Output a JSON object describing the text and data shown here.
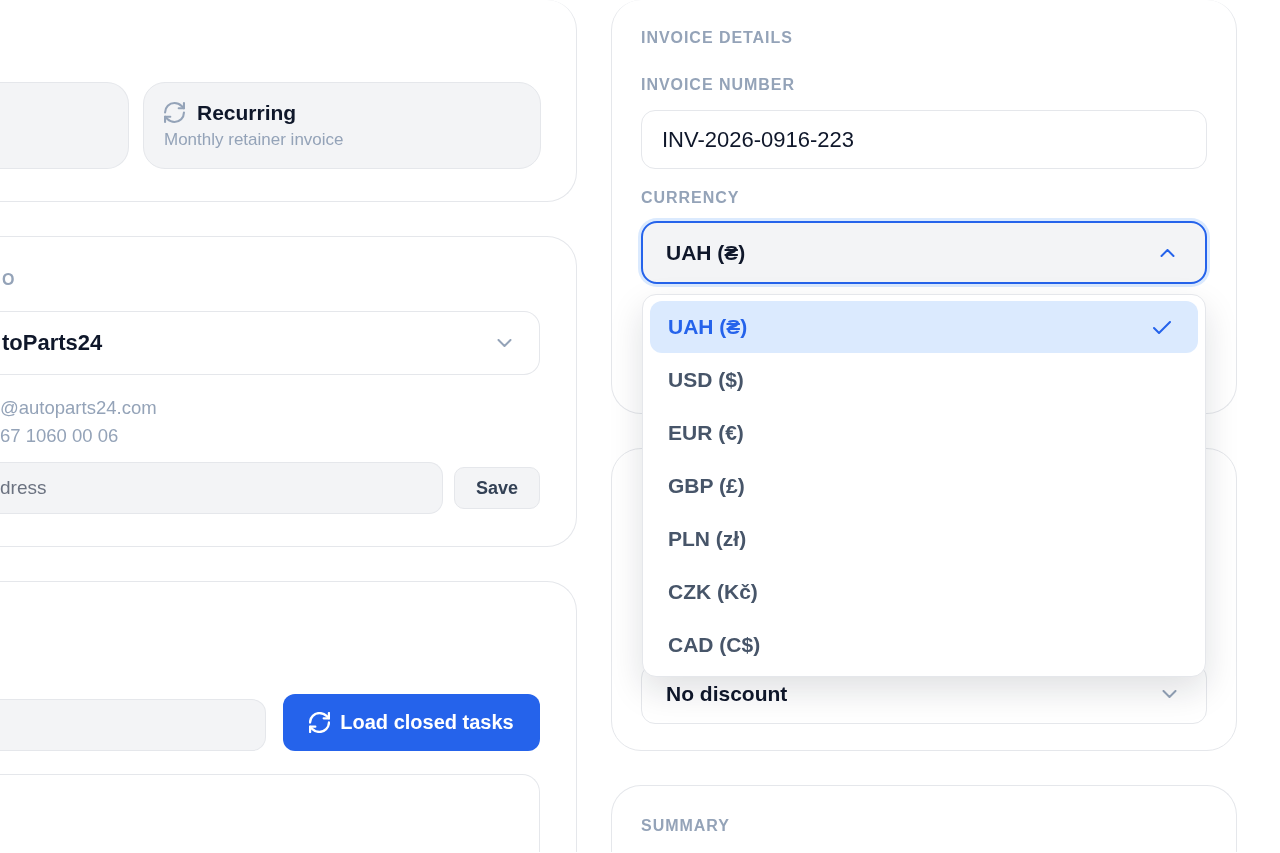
{
  "billing_type": {
    "options": [
      {
        "selected": false
      },
      {
        "title": "Recurring",
        "description": "Monthly retainer invoice",
        "selected": false
      }
    ]
  },
  "client": {
    "label": "O",
    "select": {
      "value": "toParts24"
    },
    "email": "@autoparts24.com",
    "phone": "67 1060 00 06",
    "address": {
      "placeholder": "dress"
    },
    "save_button": "Save"
  },
  "tasks": {
    "load_button": "Load closed tasks"
  },
  "invoice_details": {
    "title": "INVOICE DETAILS",
    "invoice_number": {
      "label": "INVOICE NUMBER",
      "value": "INV-2026-0916-223"
    },
    "currency": {
      "label": "CURRENCY",
      "value": "UAH (₴)",
      "expanded": true,
      "options": [
        {
          "label": "UAH (₴)",
          "selected": true
        },
        {
          "label": "USD ($)",
          "selected": false
        },
        {
          "label": "EUR (€)",
          "selected": false
        },
        {
          "label": "GBP (£)",
          "selected": false
        },
        {
          "label": "PLN (zł)",
          "selected": false
        },
        {
          "label": "CZK (Kč)",
          "selected": false
        },
        {
          "label": "CAD (C$)",
          "selected": false
        }
      ]
    }
  },
  "discount": {
    "select": {
      "value": "No discount"
    }
  },
  "summary": {
    "title": "SUMMARY"
  }
}
